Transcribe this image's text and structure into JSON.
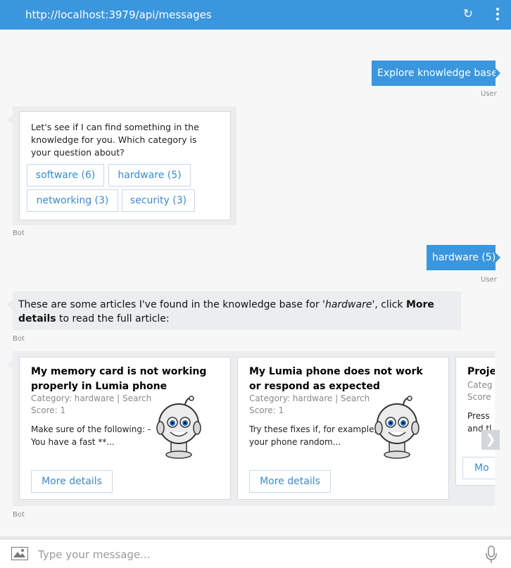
{
  "header": {
    "url": "http://localhost:3979/api/messages",
    "refresh_icon": "refresh-icon",
    "menu_icon": "more-vertical-icon"
  },
  "messages": [
    {
      "from": "User",
      "text": "Explore knowledge base",
      "label": "User"
    },
    {
      "from": "Bot",
      "label": "Bot",
      "card_text": "Let's see if I can find something in the knowledge for you. Which category is your question about?",
      "buttons": [
        "software (6)",
        "hardware (5)",
        "networking (3)",
        "security (3)"
      ]
    },
    {
      "from": "User",
      "text": "hardware (5)",
      "label": "User"
    },
    {
      "from": "Bot",
      "label": "Bot",
      "text_pre": "These are some articles I've found in the knowledge base for ",
      "text_em": "'hardware'",
      "text_mid": ", click ",
      "text_strong": "More details",
      "text_post": " to read the full article:"
    },
    {
      "from": "Bot",
      "label": "Bot",
      "cards": [
        {
          "title": "My memory card is not working properly in Lumia phone",
          "category": "Category: hardware | Search",
          "score": "Score: 1",
          "desc": "Make sure of the following: - You have a fast **...",
          "button": "More details"
        },
        {
          "title": "My Lumia phone does not work or respond as expected",
          "category": "Category: hardware | Search",
          "score": "Score: 1",
          "desc": "Try these fixes if, for example, your phone random...",
          "button": "More details"
        },
        {
          "title": "Proje",
          "category": "Categ",
          "score": "Score",
          "desc_1": "Press",
          "desc_2": "and tl",
          "button": "Mo"
        }
      ]
    }
  ],
  "composer": {
    "placeholder": "Type your message...",
    "image_icon": "image-upload-icon",
    "mic_icon": "microphone-icon"
  },
  "colors": {
    "accent": "#3a96dd",
    "background": "#f7f7f7",
    "bot_bubble": "#ebedee",
    "link": "#3a8ad4"
  }
}
